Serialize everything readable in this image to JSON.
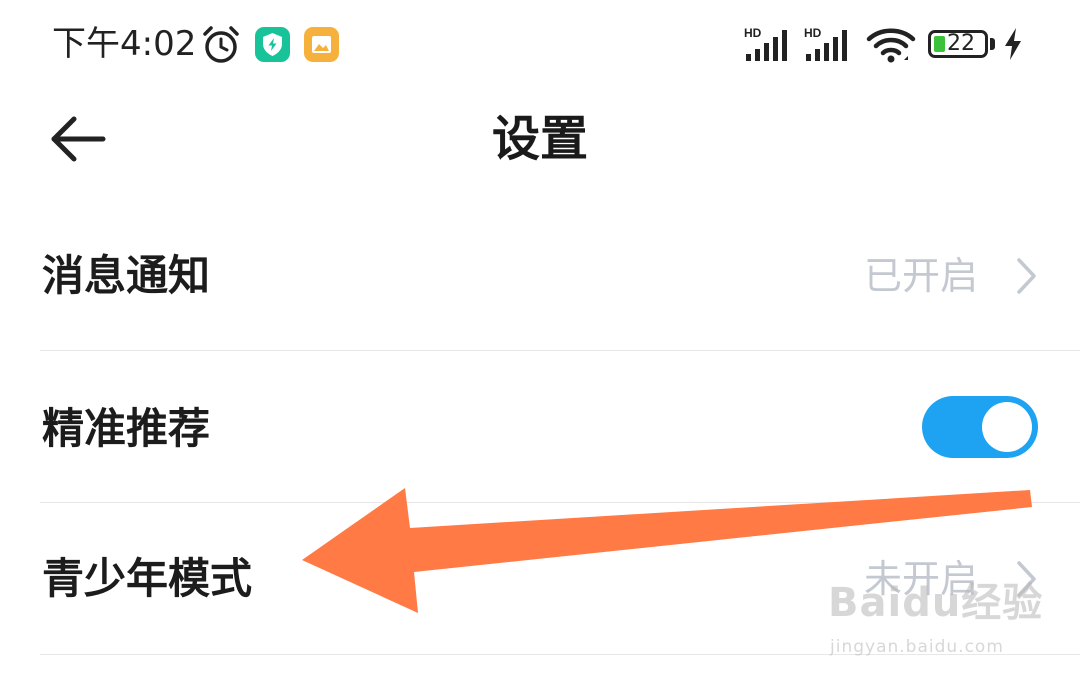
{
  "status_bar": {
    "time": "下午4:02",
    "battery_level": "22",
    "signal_label": "HD",
    "icons": [
      "alarm-icon",
      "shield-app-icon",
      "gallery-app-icon",
      "signal-icon",
      "signal-icon",
      "wifi-icon",
      "battery-icon",
      "charging-icon"
    ],
    "battery_fill_fraction": 0.22
  },
  "header": {
    "back_icon": "back-arrow-icon",
    "title": "设置"
  },
  "settings": {
    "items": [
      {
        "label": "消息通知",
        "value": "已开启",
        "control": "chevron"
      },
      {
        "label": "精准推荐",
        "control": "toggle",
        "toggle_on": true
      },
      {
        "label": "青少年模式",
        "value": "未开启",
        "control": "chevron"
      }
    ]
  },
  "overlay": {
    "arrow_color": "#ff7a45",
    "watermark_brand": "Baidu经验",
    "watermark_url": "jingyan.baidu.com"
  },
  "colors": {
    "toggle_on": "#1ea3f2",
    "value_text": "#c4c9d1",
    "battery_fill": "#3bc23b",
    "arrow": "#ff7a45"
  }
}
